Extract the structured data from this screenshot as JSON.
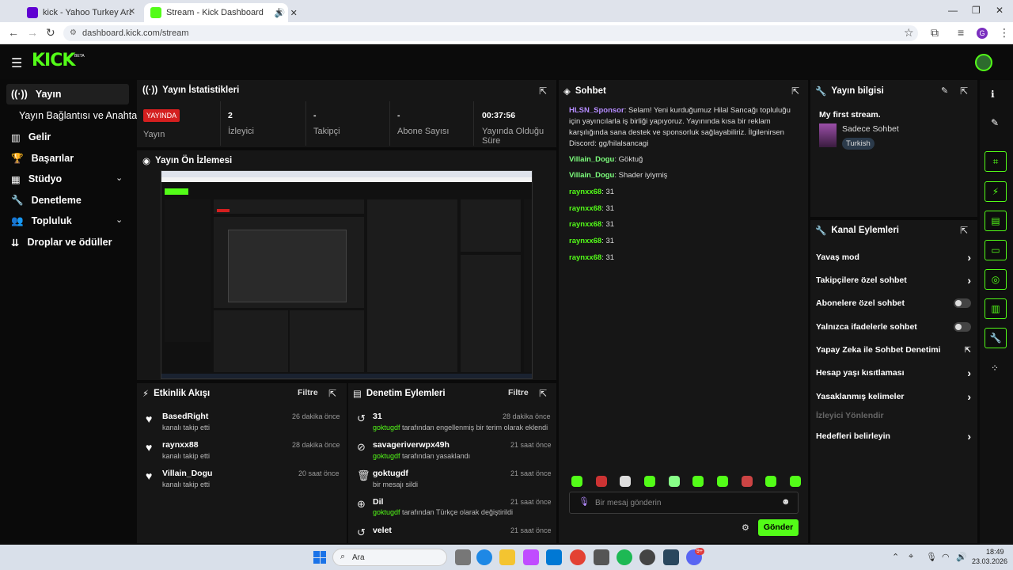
{
  "browser": {
    "tabs": [
      {
        "title": "kick - Yahoo Turkey Arama Son",
        "icon": "yahoo-icon",
        "color": "#6001d2"
      },
      {
        "title": "Stream - Kick Dashboard",
        "icon": "kick-icon",
        "color": "#53fc18"
      }
    ],
    "url": "dashboard.kick.com/stream",
    "profile_initial": "G"
  },
  "header": {
    "logo": "KICK",
    "beta": "BETA"
  },
  "sidebar": {
    "items": [
      {
        "label": "Yayın",
        "icon": "broadcast-icon"
      },
      {
        "label": "Yayın Bağlantısı ve Anahtarı",
        "icon": ""
      },
      {
        "label": "Gelir",
        "icon": "chart-icon"
      },
      {
        "label": "Başarılar",
        "icon": "trophy-icon"
      },
      {
        "label": "Stüdyo",
        "icon": "studio-icon"
      },
      {
        "label": "Denetleme",
        "icon": "wrench-icon"
      },
      {
        "label": "Topluluk",
        "icon": "community-icon"
      },
      {
        "label": "Droplar ve ödüller",
        "icon": "drops-icon"
      }
    ]
  },
  "stats": {
    "title": "Yayın İstatistikleri",
    "live_badge": "YAYINDA",
    "live_label": "Yayın",
    "items": [
      {
        "value": "2",
        "label": "İzleyici"
      },
      {
        "value": "-",
        "label": "Takipçi"
      },
      {
        "value": "-",
        "label": "Abone Sayısı"
      },
      {
        "value": "00:37:56",
        "label": "Yayında Olduğu Süre"
      }
    ]
  },
  "preview": {
    "title": "Yayın Ön İzlemesi"
  },
  "activity": {
    "title": "Etkinlik Akışı",
    "filter": "Filtre",
    "items": [
      {
        "name": "BasedRight",
        "sub": "kanalı takip etti",
        "time": "26 dakika önce"
      },
      {
        "name": "raynxx88",
        "sub": "kanalı takip etti",
        "time": "28 dakika önce"
      },
      {
        "name": "Villain_Dogu",
        "sub": "kanalı takip etti",
        "time": "20 saat önce"
      }
    ]
  },
  "moderation": {
    "title": "Denetim Eylemleri",
    "filter": "Filtre",
    "items": [
      {
        "name": "31",
        "user": "goktugdf",
        "sub": "tarafından engellenmiş bir terim olarak eklendi",
        "time": "28 dakika önce"
      },
      {
        "name": "savageriverwpx49h",
        "user": "goktugdf",
        "sub": "tarafından yasaklandı",
        "time": "21 saat önce"
      },
      {
        "name": "goktugdf",
        "user": "",
        "sub": "bir mesajı sildi",
        "time": "21 saat önce"
      },
      {
        "name": "Dil",
        "user": "goktugdf",
        "sub": "tarafından Türkçe olarak değiştirildi",
        "time": "21 saat önce"
      },
      {
        "name": "velet",
        "user": "",
        "sub": "",
        "time": "21 saat önce"
      }
    ]
  },
  "chat": {
    "title": "Sohbet",
    "messages": [
      {
        "user": "HLSN_Sponsor",
        "color": "#b58cff",
        "text": "Selam! Yeni kurduğumuz Hilal Sancağı topluluğu için yayıncılarla iş birliği yapıyoruz. Yayınında kısa bir reklam karşılığında sana destek ve sponsorluk sağlayabiliriz. İlgilenirsen Discord: gg/hilalsancagi"
      },
      {
        "user": "Villain_Dogu",
        "color": "#7dff7d",
        "text": "Göktuğ"
      },
      {
        "user": "Villain_Dogu",
        "color": "#7dff7d",
        "text": "Shader iyiymiş"
      },
      {
        "user": "raynxx68",
        "color": "#53fc18",
        "text": "31"
      },
      {
        "user": "raynxx68",
        "color": "#53fc18",
        "text": "31"
      },
      {
        "user": "raynxx68",
        "color": "#53fc18",
        "text": "31"
      },
      {
        "user": "raynxx68",
        "color": "#53fc18",
        "text": "31"
      },
      {
        "user": "raynxx68",
        "color": "#53fc18",
        "text": "31"
      }
    ],
    "placeholder": "Bir mesaj gönderin",
    "send": "Gönder"
  },
  "info": {
    "title": "Yayın bilgisi",
    "stream_title": "My first stream.",
    "category": "Sadece Sohbet",
    "tag": "Turkish"
  },
  "channel_actions": {
    "title": "Kanal Eylemleri",
    "items": [
      {
        "label": "Yavaş mod",
        "control": "chevron"
      },
      {
        "label": "Takipçilere özel sohbet",
        "control": "chevron"
      },
      {
        "label": "Abonelere özel sohbet",
        "control": "toggle"
      },
      {
        "label": "Yalnızca ifadelerle sohbet",
        "control": "toggle"
      },
      {
        "label": "Yapay Zeka ile Sohbet Denetimi",
        "control": "external"
      },
      {
        "label": "Hesap yaşı kısıtlaması",
        "control": "chevron"
      },
      {
        "label": "Yasaklanmış kelimeler",
        "control": "chevron"
      },
      {
        "label": "İzleyici Yönlendir",
        "control": "disabled"
      },
      {
        "label": "Hedefleri belirleyin",
        "control": "chevron"
      }
    ]
  },
  "taskbar": {
    "search": "Ara",
    "time": "18:49",
    "date": "23.03.2026",
    "badge": "9+"
  }
}
